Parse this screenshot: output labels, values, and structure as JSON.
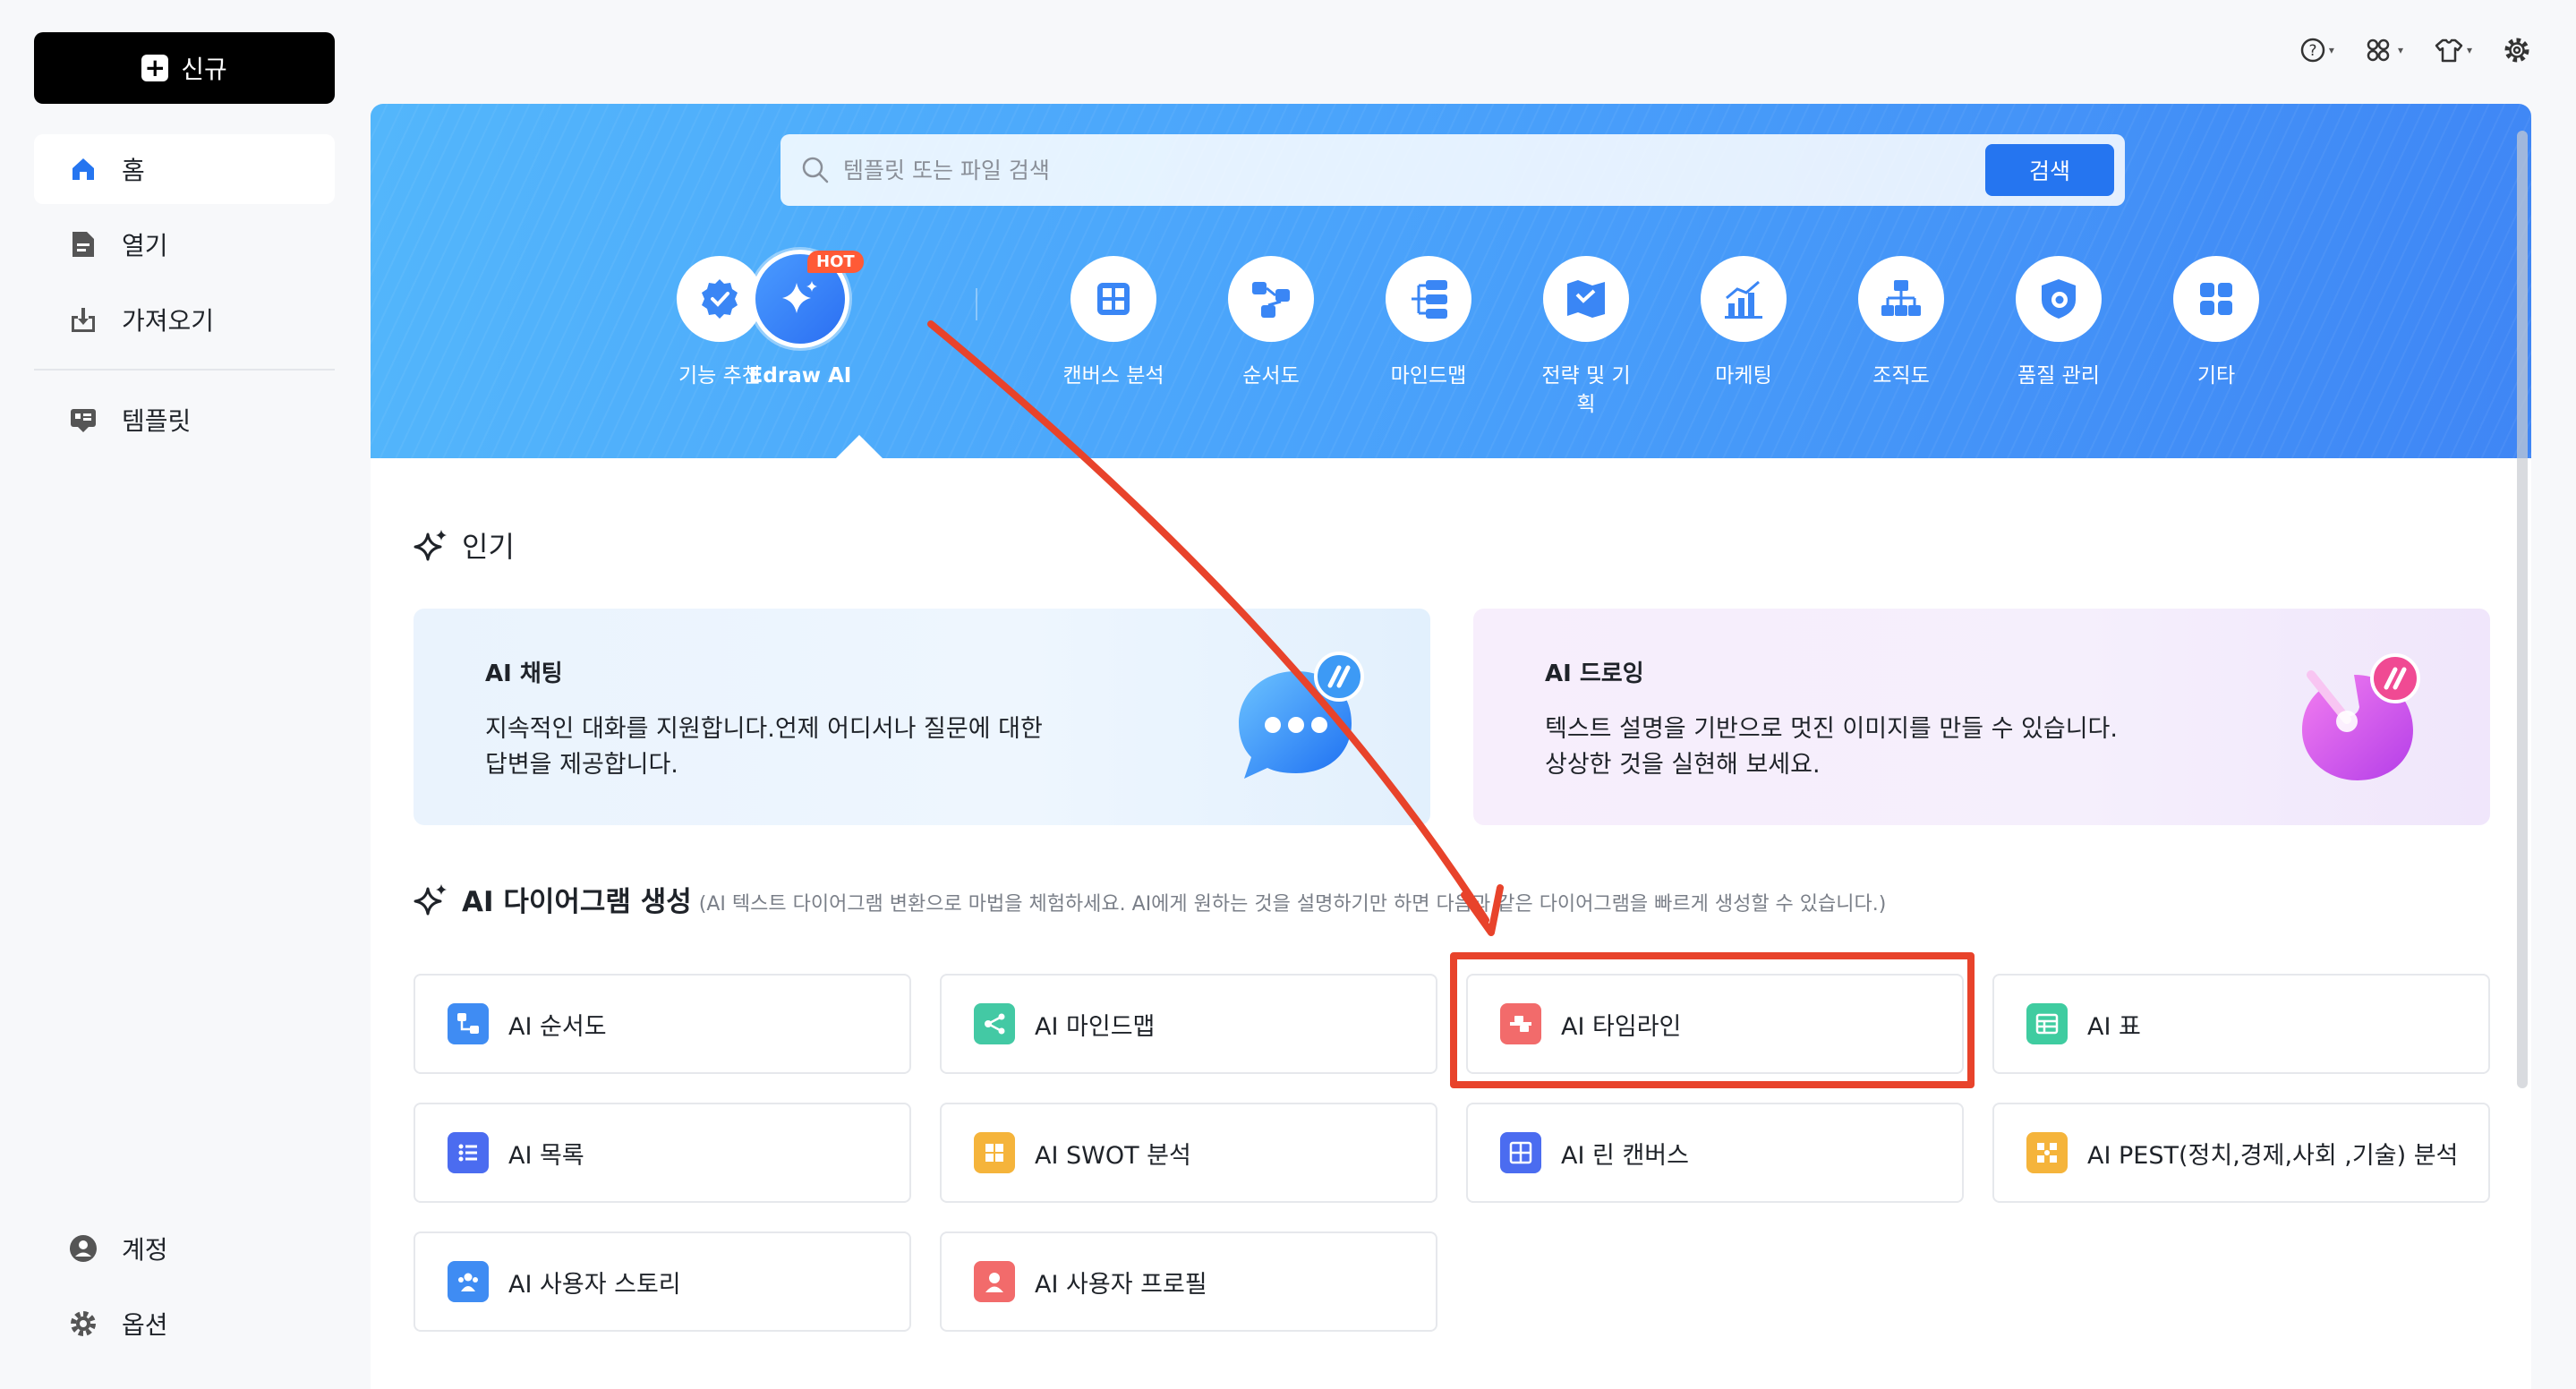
{
  "sidebar": {
    "new_label": "신규",
    "items": [
      {
        "label": "홈",
        "icon": "home-icon"
      },
      {
        "label": "열기",
        "icon": "open-file-icon"
      },
      {
        "label": "가져오기",
        "icon": "import-icon"
      },
      {
        "label": "템플릿",
        "icon": "template-icon"
      }
    ],
    "bottom": [
      {
        "label": "계정",
        "icon": "account-icon"
      },
      {
        "label": "옵션",
        "icon": "gear-icon"
      }
    ]
  },
  "search": {
    "placeholder": "템플릿 또는 파일 검색",
    "button": "검색"
  },
  "categories": [
    {
      "label": "기능 추천",
      "icon": "recommend-icon"
    },
    {
      "label": "Edraw AI",
      "icon": "ai-sparkle-icon",
      "badge": "HOT"
    },
    {
      "label": "캔버스 분석",
      "icon": "canvas-icon"
    },
    {
      "label": "순서도",
      "icon": "flowchart-icon"
    },
    {
      "label": "마인드맵",
      "icon": "mindmap-icon"
    },
    {
      "label": "전략 및 기획",
      "icon": "strategy-icon"
    },
    {
      "label": "마케팅",
      "icon": "marketing-icon"
    },
    {
      "label": "조직도",
      "icon": "orgchart-icon"
    },
    {
      "label": "품질 관리",
      "icon": "quality-icon"
    },
    {
      "label": "기타",
      "icon": "others-icon"
    }
  ],
  "popular": {
    "title": "인기",
    "cards": [
      {
        "title": "AI 채팅",
        "desc": "지속적인 대화를 지원합니다.언제 어디서나 질문에 대한 답변을 제공합니다."
      },
      {
        "title": "AI 드로잉",
        "desc": "텍스트 설명을 기반으로 멋진 이미지를 만들 수 있습니다.상상한 것을 실현해 보세요."
      }
    ]
  },
  "ai_gen": {
    "title": "AI 다이어그램 생성",
    "subtitle": "(AI 텍스트 다이어그램 변환으로 마법을 체험하세요. AI에게 원하는 것을 설명하기만 하면 다음과 같은 다이어그램을 빠르게 생성할 수 있습니다.)",
    "tools": [
      {
        "label": "AI 순서도",
        "color": "#3f8cf3"
      },
      {
        "label": "AI 마인드맵",
        "color": "#43c9a4"
      },
      {
        "label": "AI 타임라인",
        "color": "#f26b6b"
      },
      {
        "label": "AI 표",
        "color": "#3fcca0"
      },
      {
        "label": "AI 목록",
        "color": "#4b6cf0"
      },
      {
        "label": "AI SWOT 분석",
        "color": "#f5b43b"
      },
      {
        "label": "AI 린 캔버스",
        "color": "#4b6cf0"
      },
      {
        "label": "AI PEST(정치,경제,사회 ,기술) 분석",
        "color": "#f5b43b"
      },
      {
        "label": "AI 사용자 스토리",
        "color": "#3f8cf3"
      },
      {
        "label": "AI 사용자 프로필",
        "color": "#f26b6b"
      }
    ]
  },
  "colors": {
    "accent": "#2575f0",
    "highlight": "#e8432b"
  }
}
